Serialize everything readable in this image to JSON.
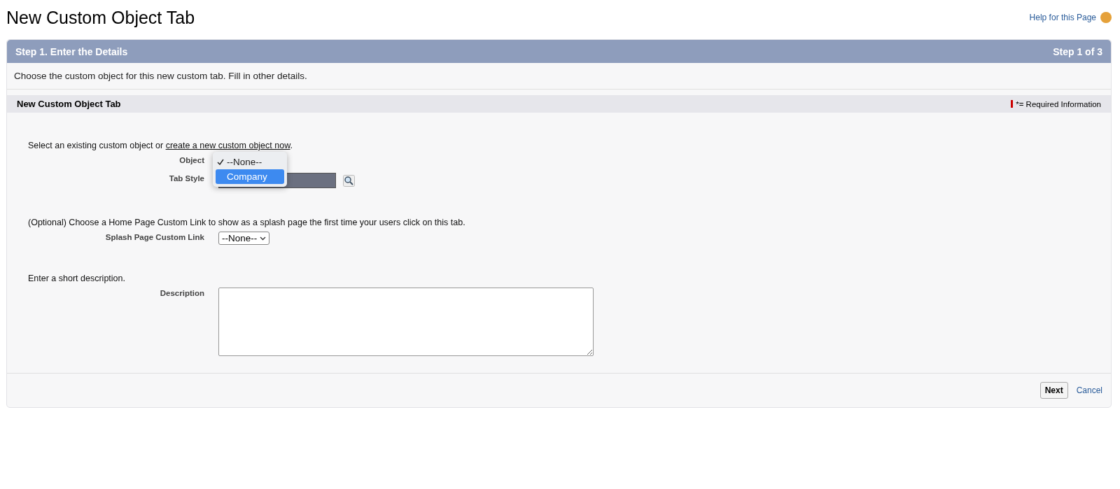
{
  "page": {
    "title": "New Custom Object Tab",
    "help_link": "Help for this Page"
  },
  "step": {
    "title": "Step 1. Enter the Details",
    "counter": "Step 1 of 3",
    "instructions": "Choose the custom object for this new custom tab. Fill in other details."
  },
  "section": {
    "title": "New Custom Object Tab",
    "required_legend": "*= Required Information"
  },
  "object_prompt": {
    "text": "Select an existing custom object or ",
    "link": "create a new custom object now",
    "end": "."
  },
  "object_field": {
    "label": "Object",
    "options": [
      {
        "label": "--None--",
        "checked": true,
        "selected": false
      },
      {
        "label": "Company",
        "checked": false,
        "selected": true
      }
    ]
  },
  "tab_style_field": {
    "label": "Tab Style"
  },
  "splash_prompt": "(Optional) Choose a Home Page Custom Link to show as a splash page the first time your users click on this tab.",
  "splash_field": {
    "label": "Splash Page Custom Link",
    "value": "--None--"
  },
  "description_prompt": "Enter a short description.",
  "description_field": {
    "label": "Description"
  },
  "buttons": [
    {
      "kind": "button",
      "label": "Next"
    },
    {
      "kind": "link",
      "label": "Cancel"
    }
  ]
}
